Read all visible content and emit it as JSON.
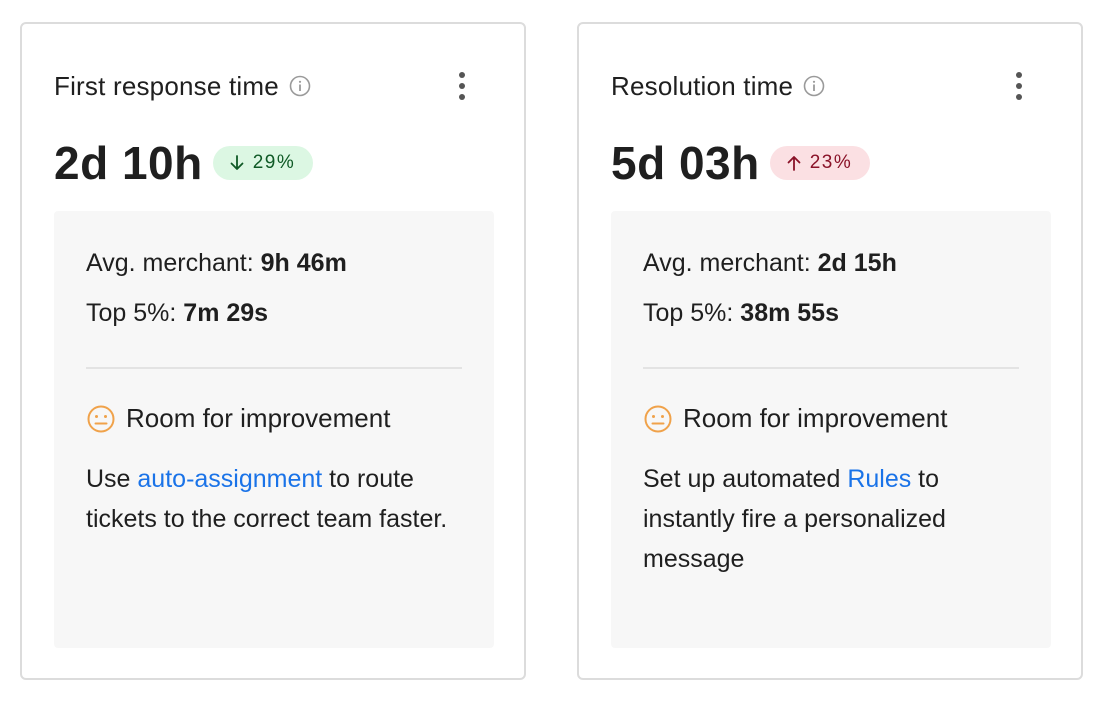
{
  "cards": [
    {
      "title": "First response time",
      "value": "2d 10h",
      "delta": {
        "direction": "down",
        "text": "29%",
        "sentiment": "positive"
      },
      "benchmarks": {
        "avg_label": "Avg. merchant:",
        "avg_value": "9h 46m",
        "top_label": "Top 5%:",
        "top_value": "7m 29s"
      },
      "tip": {
        "title": "Room for improvement",
        "before": "Use ",
        "link": "auto-assignment",
        "after": " to route tickets to the correct team faster."
      }
    },
    {
      "title": "Resolution time",
      "value": "5d 03h",
      "delta": {
        "direction": "up",
        "text": "23%",
        "sentiment": "negative"
      },
      "benchmarks": {
        "avg_label": "Avg. merchant:",
        "avg_value": "2d 15h",
        "top_label": "Top 5%:",
        "top_value": "38m 55s"
      },
      "tip": {
        "title": "Room for improvement",
        "before": "Set up automated ",
        "link": "Rules",
        "after": " to instantly fire a personalized message"
      }
    }
  ],
  "colors": {
    "positive_bg": "#dcf7e3",
    "positive_fg": "#0f5a26",
    "negative_bg": "#fbe0e3",
    "negative_fg": "#8a1228",
    "link": "#1a73e8",
    "face_icon": "#f0a24a"
  },
  "icons": {
    "info": "info-circle-icon",
    "menu": "more-vertical-icon",
    "face": "neutral-face-icon",
    "arrow_down": "arrow-down-icon",
    "arrow_up": "arrow-up-icon"
  }
}
